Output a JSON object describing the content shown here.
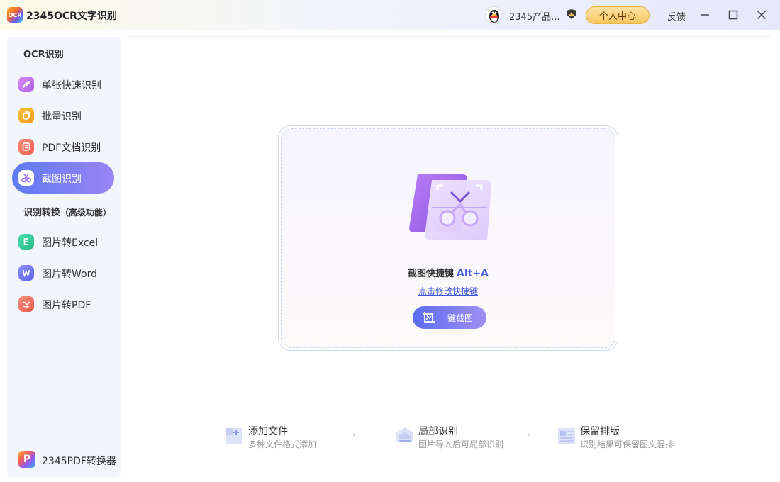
{
  "app": {
    "logo_text": "OCR",
    "title": "2345OCR文字识别",
    "user_name": "2345产品...",
    "user_center_label": "个人中心",
    "feedback_label": "反馈"
  },
  "sidebar": {
    "section1_title": "OCR识别",
    "items1": [
      {
        "label": "单张快速识别",
        "icon": "rocket-icon",
        "color": "#c56cf0"
      },
      {
        "label": "批量识别",
        "icon": "batch-icon",
        "color": "#f5a524"
      },
      {
        "label": "PDF文档识别",
        "icon": "pdf-doc-icon",
        "color": "#f26d5b"
      },
      {
        "label": "截图识别",
        "icon": "scissors-icon",
        "color": "#ffffff",
        "active": true
      }
    ],
    "section2_title": "识别转换",
    "section2_suffix": "（高级功能）",
    "items2": [
      {
        "label": "图片转Excel",
        "icon": "excel-icon",
        "color": "#36c99a"
      },
      {
        "label": "图片转Word",
        "icon": "word-icon",
        "color": "#6c6ff2"
      },
      {
        "label": "图片转PDF",
        "icon": "pdf-icon",
        "color": "#f46b5d"
      }
    ],
    "pdf_converter_label": "2345PDF转换器",
    "pdf_converter_logo": "P"
  },
  "main": {
    "shortcut_label": "截图快捷键",
    "shortcut_keys": "Alt+A",
    "modify_shortcut_link": "点击修改快捷键",
    "capture_button_label": "一键截图"
  },
  "features": [
    {
      "title": "添加文件",
      "desc": "多种文件格式添加",
      "icon": "add-file-icon"
    },
    {
      "title": "局部识别",
      "desc": "图片导入后可局部识别",
      "icon": "partial-recognize-icon"
    },
    {
      "title": "保留排版",
      "desc": "识别结果可保留图文混排",
      "icon": "keep-layout-icon"
    }
  ],
  "colors": {
    "accent": "#5b6cf0",
    "accent_light": "#9a84f5",
    "vip_gold": "#f8c660"
  }
}
